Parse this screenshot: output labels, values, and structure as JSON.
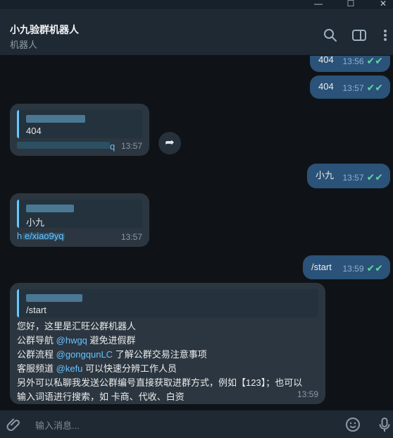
{
  "window": {
    "minimize": "—",
    "maximize": "☐",
    "close": "✕"
  },
  "header": {
    "title": "小九验群机器人",
    "subtitle": "机器人"
  },
  "messages": {
    "out1": {
      "text": "404",
      "time": "13:56"
    },
    "out2": {
      "text": "404",
      "time": "13:57"
    },
    "in1": {
      "quote_text": "404",
      "link": "q",
      "time": "13:57"
    },
    "out3": {
      "text": "小九",
      "time": "13:57"
    },
    "in2": {
      "quote_text": "小九",
      "link": "h       e/xiao9yq",
      "time": "13:57"
    },
    "out4": {
      "text": "/start",
      "time": "13:59"
    },
    "in3": {
      "quote_text": "/start",
      "line1": "您好，这里是汇旺公群机器人",
      "line2_prefix": "公群导航",
      "line2_link": "@hwgq",
      "line2_suffix": "避免进假群",
      "line3_prefix": "公群流程",
      "line3_link": "@gongqunLC",
      "line3_suffix": "了解公群交易注意事项",
      "line4_prefix": "客服频道",
      "line4_link": "@kefu",
      "line4_suffix": "可以快速分辨工作人员",
      "line5": "另外可以私聊我发送公群编号直接获取进群方式，例如【123】；也可以",
      "line6": "输入词语进行搜索，如 卡商、代收、白资",
      "time": "13:59"
    }
  },
  "composer": {
    "placeholder": "输入消息..."
  },
  "icons": {
    "search": "search-icon",
    "sidebar": "sidebar-toggle-icon",
    "more": "more-vertical-icon",
    "attach": "paperclip-icon",
    "emoji": "emoji-icon",
    "mic": "microphone-icon",
    "forward": "forward-icon"
  },
  "colors": {
    "outgoing": "#2b5278",
    "incoming": "#2b3640",
    "link": "#69c0ff",
    "check": "#5ed4a2"
  }
}
